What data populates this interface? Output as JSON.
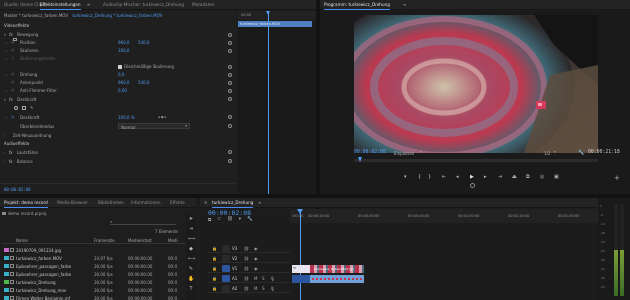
{
  "source_tabs": {
    "source_label": "Quelle: (keine Clips)",
    "effects_label": "Effekteinstellungen",
    "audio_mixer_label": "Audioclip-Mischer: turkiewicz_Drehung",
    "metadata_label": "Metadaten"
  },
  "effect_controls": {
    "master_label": "Master * turkiewicz_farben.MOV",
    "sequence_clip_label": "turkiewicz_Drehung * turkiewicz_farben.MOV",
    "ruler_time": "00:00",
    "clip_block_label": "turkiewicz_farben.MOV",
    "video_effects_header": "Videoeffekte",
    "motion_label": "Bewegung",
    "position_label": "Position",
    "position_x": "960,0",
    "position_y": "540,0",
    "scale_label": "Skalieren",
    "scale_value": "100,0",
    "scale_width_label": "Skalierungsbreite",
    "uniform_scale_label": "Gleichmäßige Skalierung",
    "rotation_label": "Drehung",
    "rotation_value": "0,0",
    "anchor_label": "Ankerpunkt",
    "anchor_x": "960,0",
    "anchor_y": "540,0",
    "flicker_label": "Anti-Flimmer-Filter",
    "flicker_value": "0,00",
    "opacity_label": "Deckkraft",
    "opacity_sub_label": "Deckkraft",
    "opacity_value": "100,0 %",
    "blend_label": "Überblendmodus",
    "blend_value": "Normal",
    "time_remap_label": "Zeit-Neuzuordnung",
    "audio_effects_header": "Audioeffekte",
    "volume_label": "Lautstärke",
    "balance_label": "Balance",
    "bottom_timecode": "00:00:02:08"
  },
  "program_monitor": {
    "title": "Programm: turkiewicz_Drehung",
    "timecode": "00:00:02:08",
    "fit_label": "Einpassen",
    "resolution": "1/2",
    "duration": "00:00:21:18",
    "image_colors": {
      "background": "#2a2628",
      "record_red": "#c23a52",
      "record_teal": "#3f6a78",
      "accent_light": "#d43a5c"
    }
  },
  "project_panel": {
    "tab_project": "Projekt: demo record",
    "tab_media_browser": "Media-Browser",
    "tab_libraries": "Bibliotheken",
    "tab_info": "Informationen",
    "tab_effects": "Effekte",
    "project_file": "demo record.prproj",
    "item_count": "7 Elemente",
    "col_name": "Name",
    "col_framerate": "Framerate",
    "col_media_start": "Medienstart",
    "col_media": "Medi",
    "items": [
      {
        "name": "20190709_091224.jpg",
        "framerate": "",
        "start": "",
        "media": "",
        "color": "#c86bc8"
      },
      {
        "name": "turkiewicz_farben.MOV",
        "framerate": "24,97 fps",
        "start": "00:00:00:00",
        "media": "00:0",
        "color": "#3ab0c8"
      },
      {
        "name": "Epikoehrer_passagen_farbe",
        "framerate": "30,00 fps",
        "start": "00:00:00:00",
        "media": "00:0",
        "color": "#3ab0c8"
      },
      {
        "name": "Epikoehrer_passagen_farbe",
        "framerate": "30,00 fps",
        "start": "00:00:00:00",
        "media": "00:0",
        "color": "#3ab0c8"
      },
      {
        "name": "turkiewicz_Drehung",
        "framerate": "30,00 fps",
        "start": "00:00:00:00",
        "media": "00:0",
        "color": "#4fb84f"
      },
      {
        "name": "turkiewicz_Drehung_mov",
        "framerate": "30,00 fps",
        "start": "00:00:00:00",
        "media": "00:0",
        "color": "#3ab0c8"
      },
      {
        "name": "Filmen Walter Benjamin.mf",
        "framerate": "30,00 fps",
        "start": "00:00:00:00",
        "media": "00:0",
        "color": "#3ab0c8"
      }
    ]
  },
  "timeline": {
    "tab_label": "turkiewicz_Drehung",
    "timecode": "00:00:02:08",
    "ruler_labels": [
      ":00:00",
      "00:00:15:00",
      "00:00:30:00",
      "00:00:45:00",
      "00:01:00:00",
      "00:01:15:00",
      "00:01:30:00"
    ],
    "tracks": [
      {
        "name": "V3",
        "kind": "video"
      },
      {
        "name": "V2",
        "kind": "video"
      },
      {
        "name": "V1",
        "kind": "video"
      },
      {
        "name": "A1",
        "kind": "audio"
      },
      {
        "name": "A2",
        "kind": "audio"
      }
    ],
    "clip_label": "turkiewicz_farben.MOV [V]",
    "clip_label_short": "fx"
  },
  "vu_meter": {
    "ticks": [
      "0",
      "-6",
      "-12",
      "-18",
      "-24",
      "-30",
      "-36",
      "-42",
      "-48",
      "-54"
    ]
  }
}
